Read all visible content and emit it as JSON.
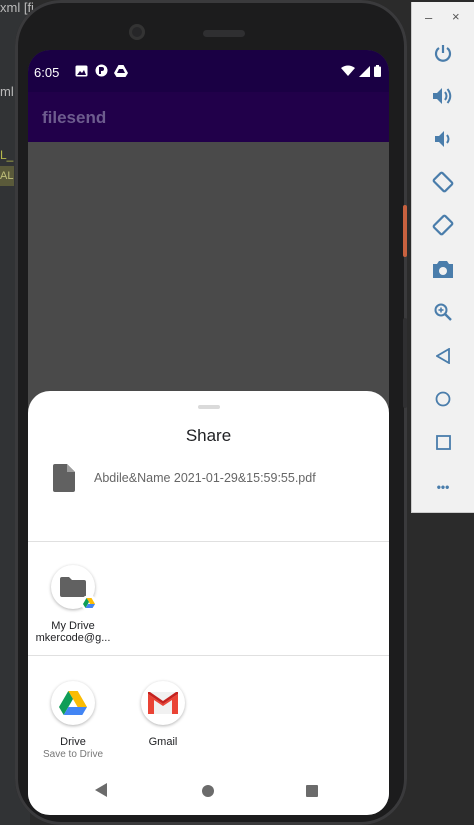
{
  "ide": {
    "title_fragment": "xml [fi",
    "ml_fragment": "ml",
    "code_fragment": "L_",
    "code_fragment2": "AL"
  },
  "status_bar": {
    "time": "6:05"
  },
  "app": {
    "title": "filesend"
  },
  "share_sheet": {
    "title": "Share",
    "file_name": "Abdile&Name 2021-01-29&15:59:55.pdf",
    "direct_targets": [
      {
        "label": "My Drive",
        "sublabel": "mkercode@g..."
      }
    ],
    "apps": [
      {
        "label": "Drive",
        "sublabel": "Save to Drive"
      },
      {
        "label": "Gmail",
        "sublabel": ""
      }
    ]
  },
  "emulator_toolbar": {
    "minimize": "–",
    "close": "×",
    "more": "•••",
    "icons": [
      "power-icon",
      "volume-up-icon",
      "volume-down-icon",
      "rotate-left-icon",
      "rotate-right-icon",
      "camera-icon",
      "zoom-icon",
      "back-icon",
      "home-icon",
      "overview-icon",
      "more-icon"
    ]
  },
  "colors": {
    "status_bar": "#1a0044",
    "app_bar": "#21004a",
    "app_title": "#6d5c8e",
    "emulator_icon": "#4a7dab"
  }
}
